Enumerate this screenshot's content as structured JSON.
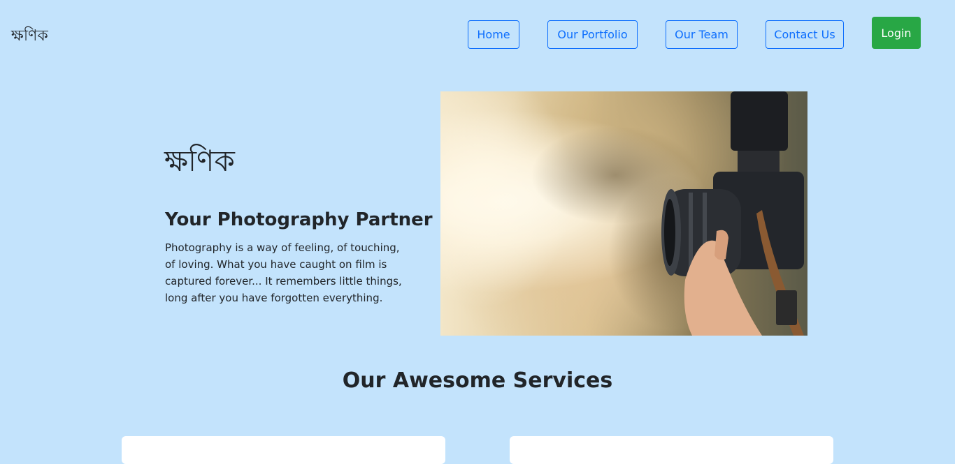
{
  "navbar": {
    "brand": "ক্ষণিক",
    "links": [
      "Home",
      "Our Portfolio",
      "Our Team",
      "Contact Us"
    ],
    "login": "Login"
  },
  "hero": {
    "title": "ক্ষণিক",
    "subtitle": "Your Photography Partner",
    "text": "Photography is a way of feeling, of touching, of loving. What you have caught on film is captured forever... It remembers little things, long after you have forgotten everything."
  },
  "services": {
    "title": "Our Awesome Services"
  },
  "colors": {
    "background": "#c3e3fc",
    "primary": "#0d6efd",
    "success": "#28a745",
    "text": "#212529"
  }
}
